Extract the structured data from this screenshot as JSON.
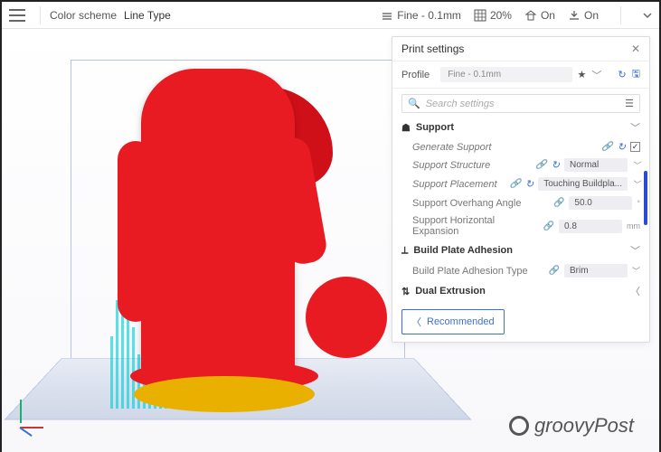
{
  "topbar": {
    "menu_label": "",
    "colorscheme_label": "Color scheme",
    "linetype_label": "Line Type",
    "quality_label": "Fine - 0.1mm",
    "infill_label": "20%",
    "support_label": "On",
    "adhesion_label": "On"
  },
  "panel": {
    "title": "Print settings",
    "profile_label": "Profile",
    "profile_value": "Fine - 0.1mm",
    "search_placeholder": "Search settings",
    "sections": {
      "support": {
        "title": "Support",
        "generate_support": {
          "label": "Generate Support",
          "checked": "✓"
        },
        "support_structure": {
          "label": "Support Structure",
          "value": "Normal"
        },
        "support_placement": {
          "label": "Support Placement",
          "value": "Touching Buildpla..."
        },
        "support_overhang": {
          "label": "Support Overhang Angle",
          "value": "50.0",
          "unit": "°"
        },
        "support_horiz": {
          "label": "Support Horizontal Expansion",
          "value": "0.8",
          "unit": "mm"
        }
      },
      "adhesion": {
        "title": "Build Plate Adhesion",
        "type": {
          "label": "Build Plate Adhesion Type",
          "value": "Brim"
        }
      },
      "dual": {
        "title": "Dual Extrusion"
      }
    },
    "recommended_label": "Recommended"
  },
  "watermark": "groovyPost"
}
